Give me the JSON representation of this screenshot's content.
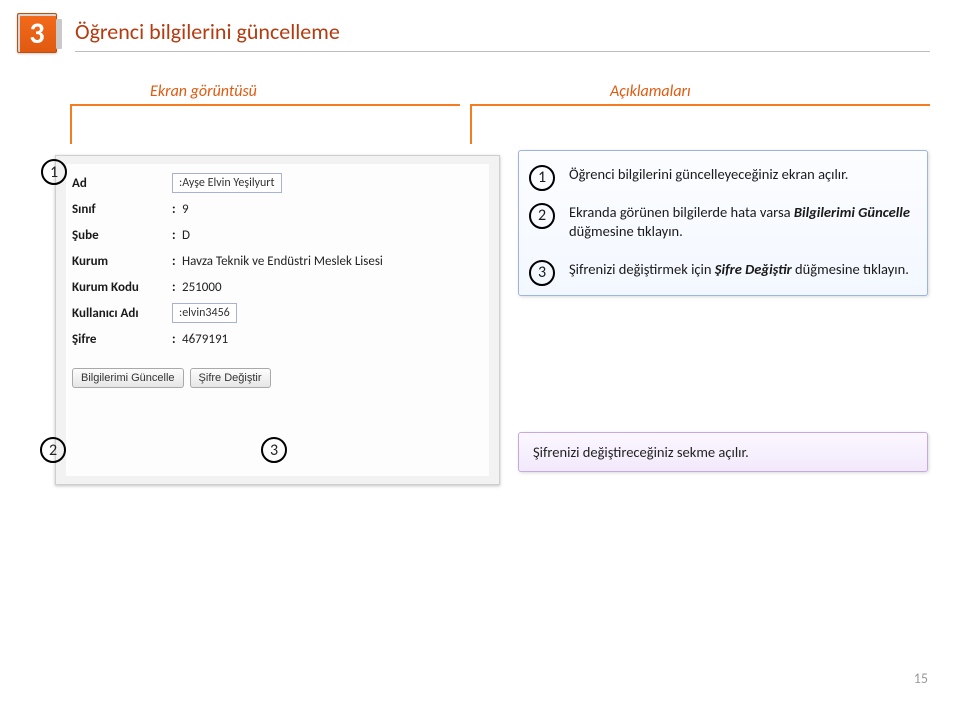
{
  "header": {
    "step_number": "3",
    "title": "Öğrenci bilgilerini güncelleme",
    "screenshot_label": "Ekran görüntüsü",
    "description_label": "Açıklamaları"
  },
  "screenshot": {
    "fields": {
      "ad_label": "Ad",
      "ad_value": ":Ayşe Elvin Yeşilyurt",
      "sinif_label": "Sınıf",
      "sinif_value": "9",
      "sube_label": "Şube",
      "sube_value": "D",
      "kurum_label": "Kurum",
      "kurum_value": "Havza Teknik ve Endüstri Meslek Lisesi",
      "kurum_kodu_label": "Kurum Kodu",
      "kurum_kodu_value": "251000",
      "kullanici_label": "Kullanıcı Adı",
      "kullanici_value": ":elvin3456",
      "sifre_label": "Şifre",
      "sifre_value": "4679191"
    },
    "buttons": {
      "update": "Bilgilerimi Güncelle",
      "change_pw": "Şifre Değiştir"
    },
    "markers": {
      "m1": "1",
      "m2": "2",
      "m3": "3"
    }
  },
  "descriptions": {
    "items": [
      {
        "n": "1",
        "text_a": "Öğrenci bilgilerini güncelleyeceğiniz ekran açılır."
      },
      {
        "n": "2",
        "text_a": "Ekranda görünen bilgilerde hata varsa ",
        "em": "Bilgilerimi Güncelle",
        "text_b": " düğmesine tıklayın."
      },
      {
        "n": "3",
        "text_a": "Şifrenizi değiştirmek için ",
        "em": "Şifre Değiştir",
        "text_b": " düğmesine tıklayın."
      }
    ]
  },
  "note": "Şifrenizi değiştireceğiniz sekme açılır.",
  "page_number": "15"
}
